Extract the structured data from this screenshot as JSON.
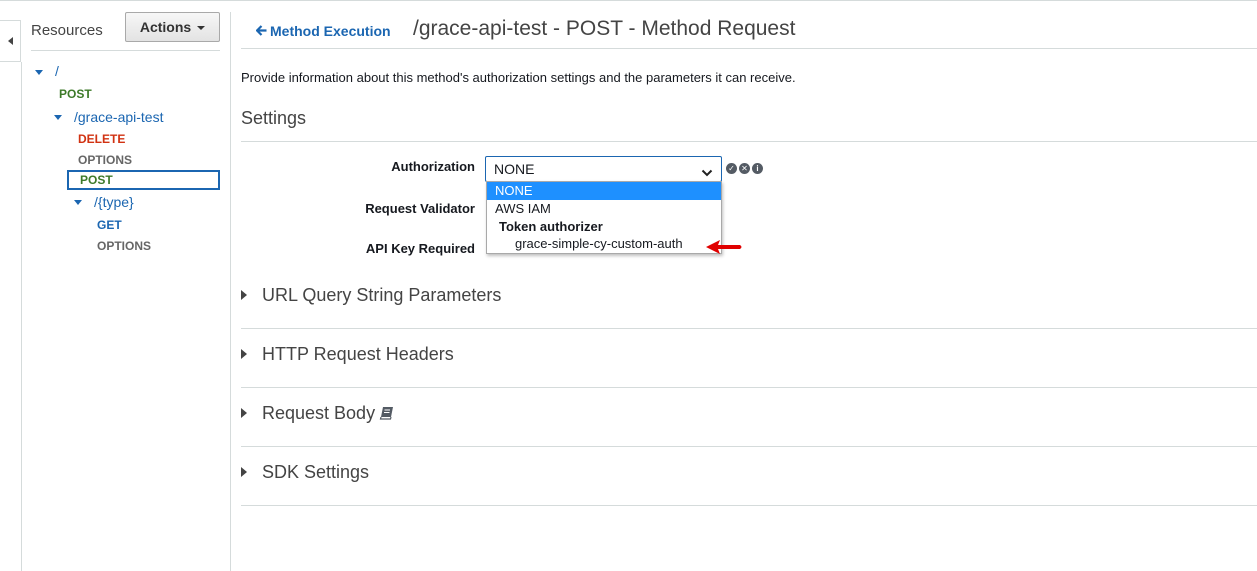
{
  "sidebar": {
    "title": "Resources",
    "actions_label": "Actions",
    "tree": {
      "root_path": "/",
      "root_post": "POST",
      "child_path": "/grace-api-test",
      "child_delete": "DELETE",
      "child_options": "OPTIONS",
      "child_post": "POST",
      "grandchild_path": "/{type}",
      "grandchild_get": "GET",
      "grandchild_options": "OPTIONS"
    }
  },
  "header": {
    "back_label": "Method Execution",
    "title": "/grace-api-test - POST - Method Request"
  },
  "main": {
    "description": "Provide information about this method's authorization settings and the parameters it can receive.",
    "settings_title": "Settings",
    "fields": {
      "authorization_label": "Authorization",
      "request_validator_label": "Request Validator",
      "api_key_label": "API Key Required"
    },
    "authorization_select": {
      "value": "NONE",
      "options": {
        "none": "NONE",
        "aws_iam": "AWS IAM",
        "group_token": "Token authorizer",
        "custom_auth": "grace-simple-cy-custom-auth"
      }
    },
    "sections": {
      "url_query": "URL Query String Parameters",
      "http_headers": "HTTP Request Headers",
      "request_body": "Request Body",
      "sdk_settings": "SDK Settings"
    }
  },
  "colors": {
    "link_blue": "#1b66b1",
    "post_green": "#3d7a29",
    "delete_red": "#d13212",
    "selected_option": "#1e90ff",
    "arrow_red": "#e00000"
  },
  "icons": {
    "status": [
      "check-circle-icon",
      "x-circle-icon",
      "info-circle-icon"
    ]
  }
}
